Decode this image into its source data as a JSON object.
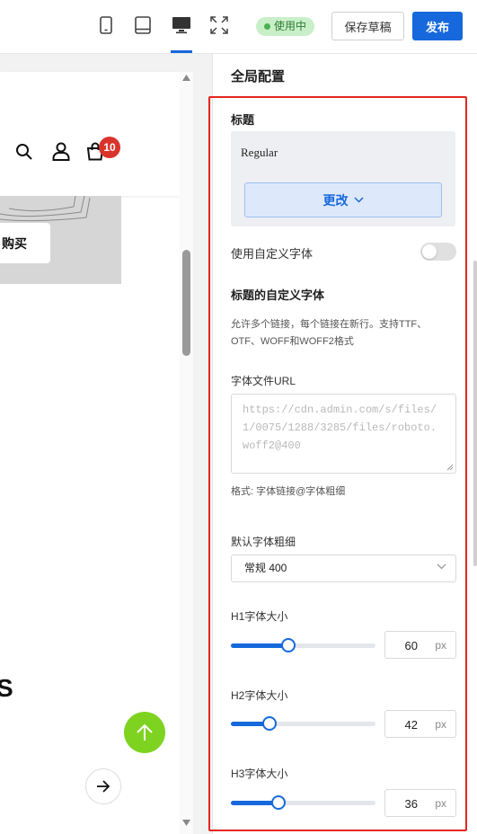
{
  "topbar": {
    "devices": [
      {
        "name": "mobile",
        "icon": "mobile-icon"
      },
      {
        "name": "tablet",
        "icon": "tablet-icon"
      },
      {
        "name": "desktop",
        "icon": "desktop-icon",
        "active": true
      },
      {
        "name": "fullscreen",
        "icon": "fullscreen-icon"
      }
    ],
    "status_badge": "使用中",
    "save_draft_label": "保存草稿",
    "publish_label": "发布",
    "accent_color": "#1668dc"
  },
  "preview": {
    "icons": [
      "search-icon",
      "user-icon",
      "cart-icon"
    ],
    "cart_count": "10",
    "buy_button": "购买",
    "section_heading_fragment": "S",
    "back_to_top_icon": "arrow-up-icon",
    "next_icon": "arrow-right-icon",
    "back_to_top_color": "#7ed321"
  },
  "panel": {
    "title": "全局配置",
    "heading_section": {
      "label": "标题",
      "font_name": "Regular",
      "change_button": "更改"
    },
    "custom_font_toggle_label": "使用自定义字体",
    "custom_font_toggle_on": false,
    "custom_font_title": "标题的自定义字体",
    "custom_font_help_line1": "允许多个链接，每个链接在新行。支持TTF、",
    "custom_font_help_line2": "OTF、WOFF和WOFF2格式",
    "font_url_label": "字体文件URL",
    "font_url_placeholder_lines": [
      "https://cdn.admin.com/s/files/",
      "1/0075/1288/3285/files/roboto.",
      "woff2@400"
    ],
    "font_url_format_hint": "格式: 字体链接@字体粗细",
    "default_weight_label": "默认字体粗细",
    "default_weight_value": "常规 400",
    "size_sliders": [
      {
        "label": "H1字体大小",
        "value": "60",
        "unit": "px",
        "level": 0.4
      },
      {
        "label": "H2字体大小",
        "value": "42",
        "unit": "px",
        "level": 0.27
      },
      {
        "label": "H3字体大小",
        "value": "36",
        "unit": "px",
        "level": 0.33
      }
    ],
    "highlight_border_color": "#e3261f"
  }
}
